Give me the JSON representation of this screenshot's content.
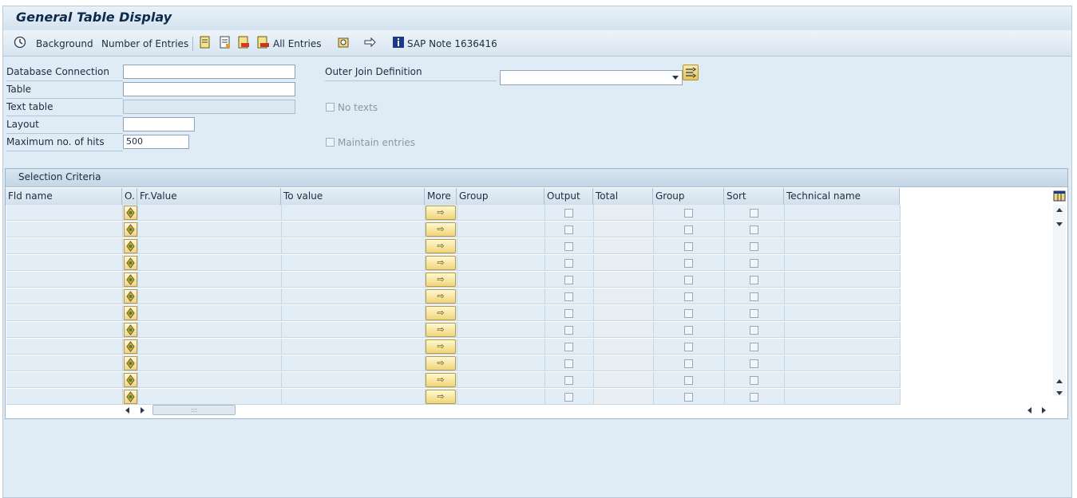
{
  "window": {
    "title": "General Table Display"
  },
  "toolbar": {
    "items": [
      {
        "label": "Background",
        "icon": "clock-execute-icon"
      },
      {
        "label": "Number of Entries",
        "icon": ""
      },
      {
        "label": "",
        "icon": "save-variant-icon"
      },
      {
        "label": "",
        "icon": "get-variant-icon"
      },
      {
        "label": "",
        "icon": "delete-variant-icon"
      },
      {
        "label": "All Entries",
        "icon": "all-entries-icon"
      },
      {
        "label": "",
        "icon": "history-icon"
      },
      {
        "label": "",
        "icon": "navigate-icon"
      },
      {
        "label": "SAP Note 1636416",
        "icon": "info-icon"
      }
    ]
  },
  "form": {
    "db_connection": {
      "label": "Database Connection",
      "value": ""
    },
    "table": {
      "label": "Table",
      "value": ""
    },
    "text_table": {
      "label": "Text table",
      "value": ""
    },
    "layout": {
      "label": "Layout",
      "value": ""
    },
    "max_hits": {
      "label": "Maximum no. of hits",
      "value": "500"
    },
    "outer_join": {
      "label": "Outer Join Definition",
      "value": ""
    },
    "no_texts": {
      "label": "No texts",
      "checked": false
    },
    "maintain_entries": {
      "label": "Maintain entries",
      "checked": false
    }
  },
  "selection": {
    "title": "Selection Criteria",
    "columns": [
      "Fld name",
      "O.",
      "Fr.Value",
      "To value",
      "More",
      "Group",
      "Output",
      "Total",
      "Group",
      "Sort",
      "Technical name"
    ],
    "row_count": 12,
    "more_symbol": "⇨"
  },
  "colors": {
    "accent": "#e4c35a",
    "panel": "#dfebf5",
    "row": "#e3edf5"
  }
}
